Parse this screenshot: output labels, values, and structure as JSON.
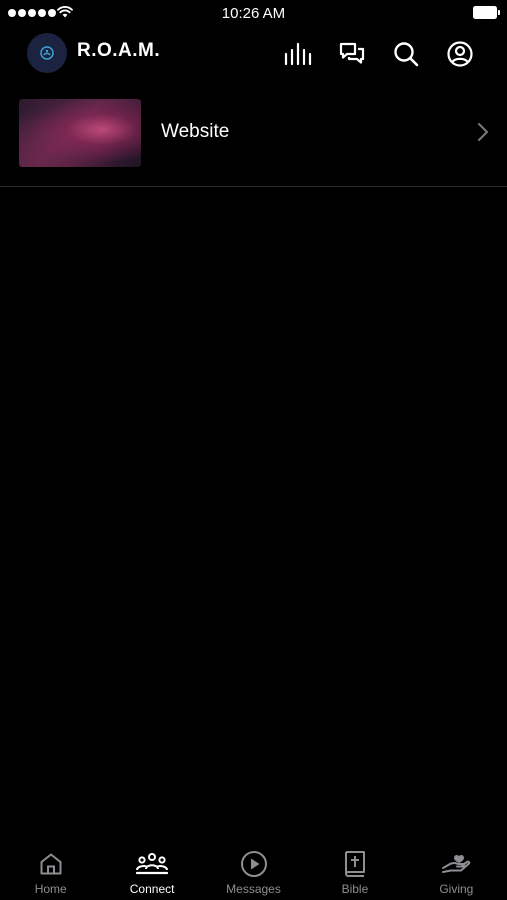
{
  "status_bar": {
    "time": "10:26 AM"
  },
  "header": {
    "title": "R.O.A.M.",
    "icons": [
      "audio-bars-icon",
      "chat-bubbles-icon",
      "search-icon",
      "account-icon"
    ]
  },
  "list": {
    "items": [
      {
        "label": "Website",
        "thumbnail": "nebula-thumbnail"
      }
    ]
  },
  "tabs": [
    {
      "label": "Home",
      "icon": "home-icon",
      "active": false
    },
    {
      "label": "Connect",
      "icon": "group-icon",
      "active": true
    },
    {
      "label": "Messages",
      "icon": "play-circle-icon",
      "active": false
    },
    {
      "label": "Bible",
      "icon": "bible-icon",
      "active": false
    },
    {
      "label": "Giving",
      "icon": "giving-hand-icon",
      "active": false
    }
  ],
  "colors": {
    "background": "#000000",
    "active_tab": "#ffffff",
    "inactive_tab": "#8e8e93",
    "divider": "#2b2b2b"
  }
}
